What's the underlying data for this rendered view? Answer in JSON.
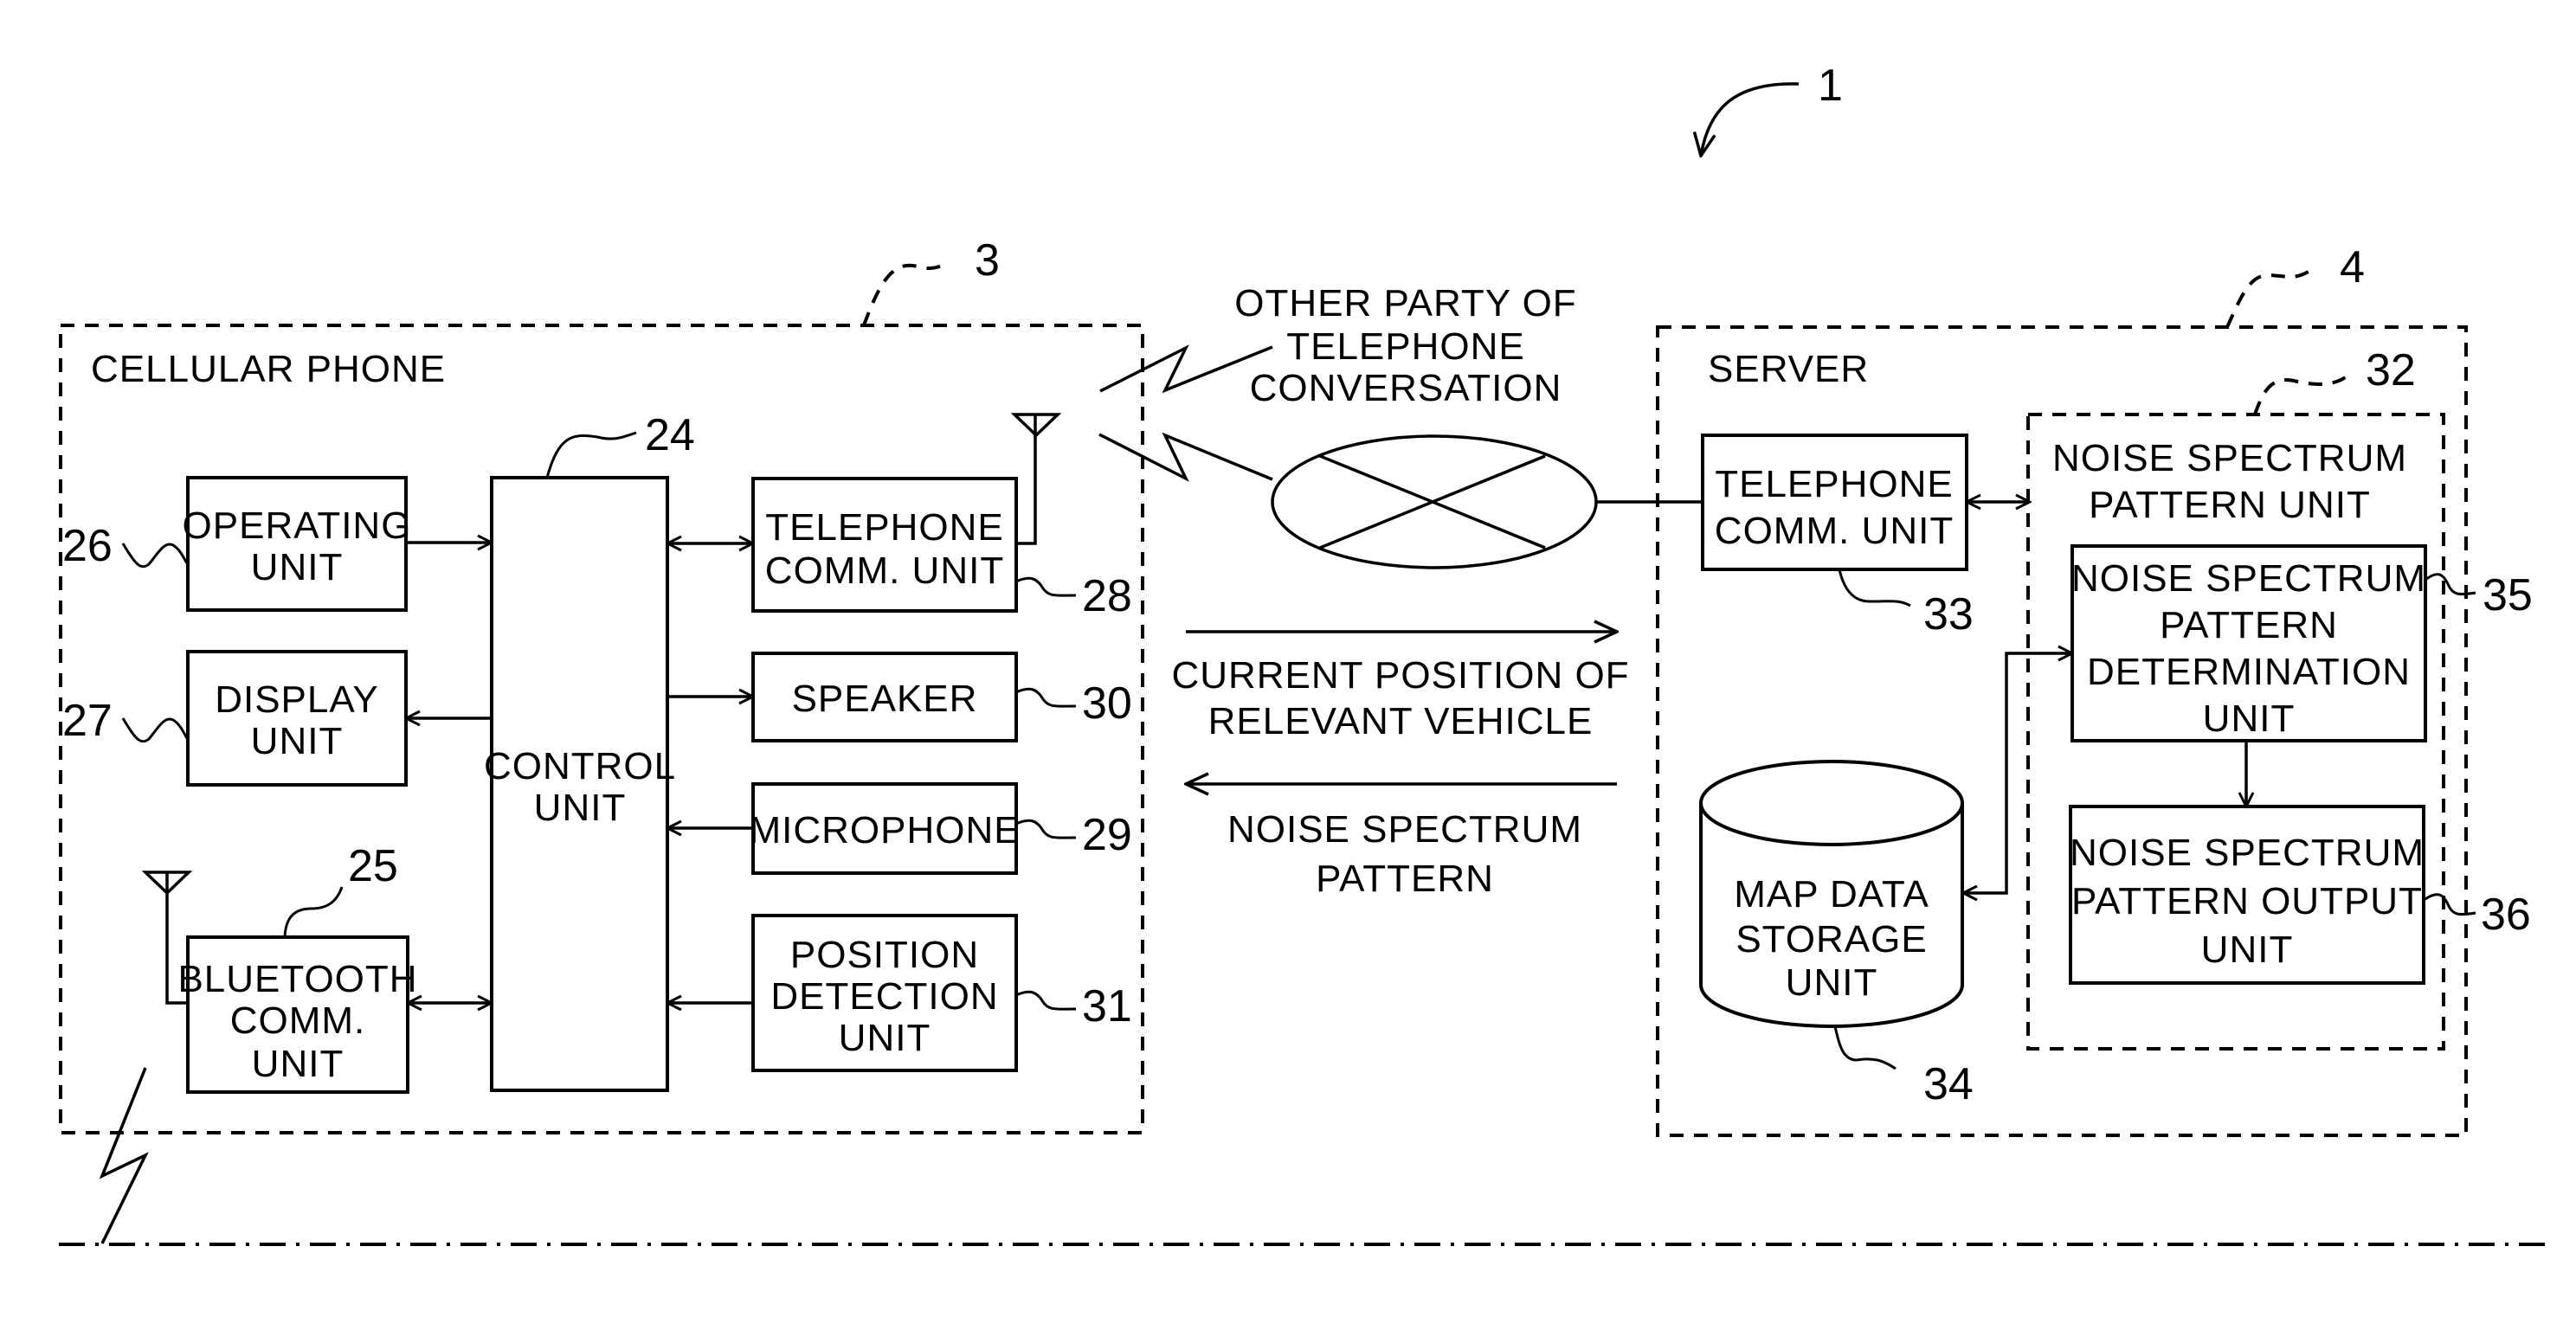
{
  "figure": {
    "system_ref": "1",
    "colors": {
      "ink": "#000000",
      "paper": "#ffffff"
    }
  },
  "cellular_phone": {
    "title": "CELLULAR PHONE",
    "ref": "3",
    "control_unit": {
      "lines": [
        "CONTROL",
        "UNIT"
      ],
      "ref": "24"
    },
    "operating_unit": {
      "lines": [
        "OPERATING",
        "UNIT"
      ],
      "ref": "26"
    },
    "display_unit": {
      "lines": [
        "DISPLAY",
        "UNIT"
      ],
      "ref": "27"
    },
    "bluetooth_unit": {
      "lines": [
        "BLUETOOTH",
        "COMM.",
        "UNIT"
      ],
      "ref": "25"
    },
    "telephone_unit": {
      "lines": [
        "TELEPHONE",
        "COMM. UNIT"
      ],
      "ref": "28"
    },
    "speaker": {
      "lines": [
        "SPEAKER"
      ],
      "ref": "30"
    },
    "microphone": {
      "lines": [
        "MICROPHONE"
      ],
      "ref": "29"
    },
    "position_unit": {
      "lines": [
        "POSITION",
        "DETECTION",
        "UNIT"
      ],
      "ref": "31"
    }
  },
  "network": {
    "other_party_lines": [
      "OTHER PARTY OF",
      "TELEPHONE",
      "CONVERSATION"
    ],
    "uplink_lines": [
      "CURRENT POSITION OF",
      "RELEVANT VEHICLE"
    ],
    "downlink_lines": [
      "NOISE SPECTRUM",
      "PATTERN"
    ]
  },
  "server": {
    "title": "SERVER",
    "ref": "4",
    "telephone_unit": {
      "lines": [
        "TELEPHONE",
        "COMM. UNIT"
      ],
      "ref": "33"
    },
    "map_storage": {
      "lines": [
        "MAP DATA",
        "STORAGE",
        "UNIT"
      ],
      "ref": "34"
    },
    "nsp_unit": {
      "lines": [
        "NOISE SPECTRUM",
        "PATTERN UNIT"
      ],
      "ref": "32",
      "determination": {
        "lines": [
          "NOISE SPECTRUM",
          "PATTERN",
          "DETERMINATION",
          "UNIT"
        ],
        "ref": "35"
      },
      "output": {
        "lines": [
          "NOISE SPECTRUM",
          "PATTERN OUTPUT",
          "UNIT"
        ],
        "ref": "36"
      }
    }
  }
}
